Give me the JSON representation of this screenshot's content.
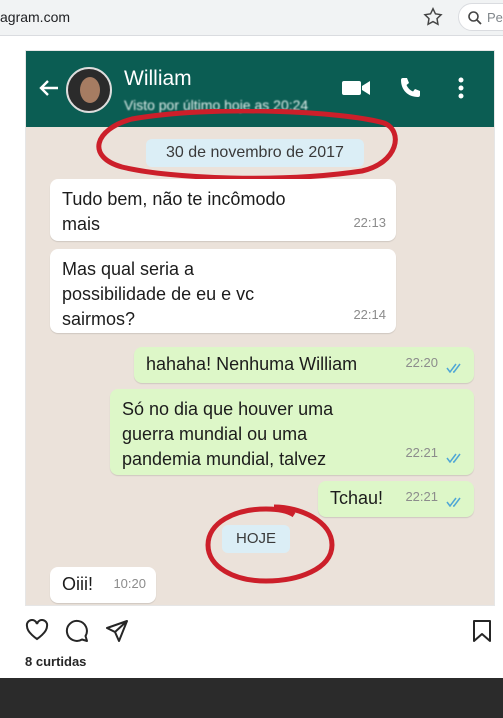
{
  "browser": {
    "url": "agram.com",
    "search_placeholder": "Pe"
  },
  "chat": {
    "contact_name": "William",
    "last_seen": "Visto por último hoje as 20:24",
    "date_chip": "30 de novembro de 2017",
    "today_chip": "HOJE",
    "messages": [
      {
        "direction": "in",
        "lines": [
          "Tudo bem, não te incômodo",
          "mais"
        ],
        "time": "22:13"
      },
      {
        "direction": "in",
        "lines": [
          "Mas qual seria a",
          "possibilidade de eu e vc",
          "sairmos?"
        ],
        "time": "22:14"
      },
      {
        "direction": "out",
        "lines": [
          "hahaha! Nenhuma William"
        ],
        "time": "22:20"
      },
      {
        "direction": "out",
        "lines": [
          "Só no dia que houver uma",
          "guerra mundial ou uma",
          "pandemia mundial, talvez"
        ],
        "time": "22:21"
      },
      {
        "direction": "out",
        "lines": [
          "Tchau!"
        ],
        "time": "22:21"
      },
      {
        "direction": "in",
        "lines": [
          "Oiii!"
        ],
        "time": "10:20"
      }
    ],
    "colors": {
      "header": "#0b5d53",
      "outgoing": "#ddf7c8",
      "incoming": "#ffffff",
      "annotation": "#cc1f2a"
    }
  },
  "post": {
    "likes": "8 curtidas",
    "icons": [
      "heart-icon",
      "comment-icon",
      "share-icon",
      "bookmark-icon"
    ]
  }
}
